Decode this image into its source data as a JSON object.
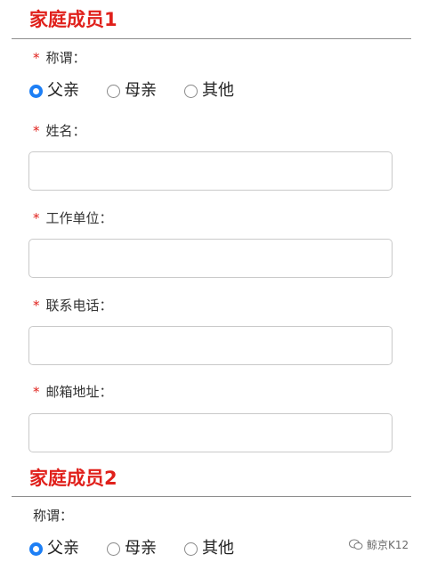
{
  "section1": {
    "title": "家庭成员1",
    "relation": {
      "label": "称谓：",
      "required": "*",
      "options": [
        "父亲",
        "母亲",
        "其他"
      ],
      "selected": "父亲"
    },
    "fields": [
      {
        "label": "姓名：",
        "required": "*",
        "value": ""
      },
      {
        "label": "工作单位：",
        "required": "*",
        "value": ""
      },
      {
        "label": "联系电话：",
        "required": "*",
        "value": ""
      },
      {
        "label": "邮箱地址：",
        "required": "*",
        "value": ""
      }
    ]
  },
  "section2": {
    "title": "家庭成员2",
    "relation": {
      "label": "称谓：",
      "options": [
        "父亲",
        "母亲",
        "其他"
      ],
      "selected": "父亲"
    }
  },
  "watermark": {
    "text": "鲸京K12",
    "icon": "wechat-logo-icon"
  },
  "colors": {
    "accent": "#e0201b",
    "radio_selected": "#1d7ff5",
    "border": "#c9c9c9"
  }
}
